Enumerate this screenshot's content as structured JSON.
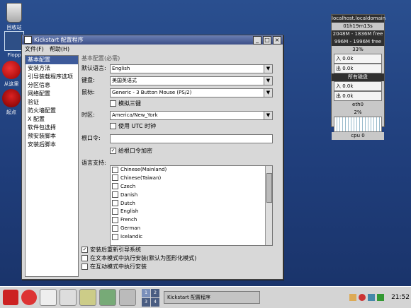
{
  "desktop": {
    "icons": [
      {
        "label": "回收站",
        "icon": "trash-icon"
      },
      {
        "label": "Flopp",
        "icon": "floppy-icon"
      },
      {
        "label": "从这里",
        "icon": "home-icon"
      },
      {
        "label": "起点",
        "icon": "start-icon"
      }
    ]
  },
  "monitor": {
    "host": "localhost.localdomain",
    "uptime": "01h19m13s",
    "mem": "2048M - 1836M free",
    "swap": "996M - 1996M free",
    "load": "33%",
    "net_in": "入 0.0k",
    "net_out": "出 0.0k",
    "disks_label": "所有磁盘",
    "disk_in": "入 0.0k",
    "disk_out": "出 0.0k",
    "iface": "eth0",
    "cpu_pct": "2%",
    "cpu_label": "cpu 0"
  },
  "window": {
    "title": "Kickstart 配置程序",
    "menu": [
      "文件(F)",
      "帮助(H)"
    ],
    "sidebar": [
      "基本配置",
      "安装方法",
      "引导装载程序选项",
      "分区信息",
      "网络配置",
      "验证",
      "防火墙配置",
      "X 配置",
      "软件包选择",
      "预安装脚本",
      "安装后脚本"
    ],
    "section_title": "基本配置(必需)",
    "language_label": "默认语言:",
    "language_value": "English",
    "keyboard_label": "键盘:",
    "keyboard_value": "美国英语式",
    "mouse_label": "鼠标:",
    "mouse_value": "Generic - 3 Button Mouse (PS/2)",
    "emulate_label": "模拟三键",
    "timezone_label": "时区:",
    "timezone_value": "America/New_York",
    "utc_label": "使用 UTC 时钟",
    "root_pw_label": "根口令:",
    "root_pw_value": "",
    "encrypt_label": "给根口令加密",
    "lang_support_label": "语言支持:",
    "languages": [
      "Chinese(Mainland)",
      "Chinese(Taiwan)",
      "Czech",
      "Danish",
      "Dutch",
      "English",
      "French",
      "German",
      "Icelandic"
    ],
    "options": [
      {
        "label": "安装后重新引导系统",
        "checked": true
      },
      {
        "label": "在文本模式中执行安装(默认为图形化模式)",
        "checked": false
      },
      {
        "label": "在互动模式中执行安装",
        "checked": false
      }
    ]
  },
  "taskbar": {
    "workspaces": [
      "1",
      "2",
      "3",
      "4"
    ],
    "task": "Kickstart 配置程序",
    "clock": "21:52"
  }
}
